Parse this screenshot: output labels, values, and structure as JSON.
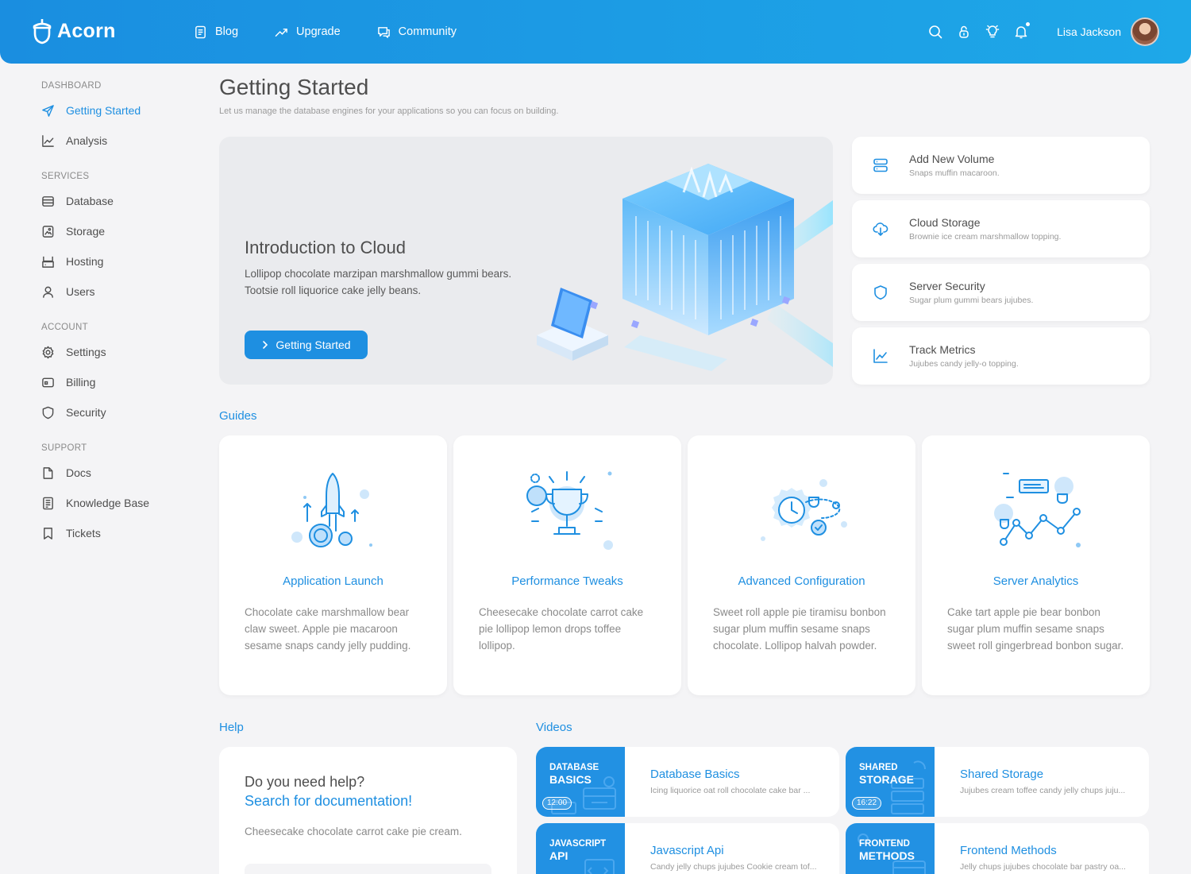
{
  "app": {
    "name": "Acorn"
  },
  "topnav": [
    {
      "label": "Blog",
      "icon": "blog-icon"
    },
    {
      "label": "Upgrade",
      "icon": "trend-up-icon"
    },
    {
      "label": "Community",
      "icon": "chat-icon"
    }
  ],
  "topbar_right": {
    "icons": [
      "search-icon",
      "lock-icon",
      "lightbulb-icon",
      "bell-icon"
    ],
    "user_name": "Lisa Jackson"
  },
  "sidebar": {
    "sections": [
      {
        "title": "DASHBOARD",
        "items": [
          {
            "label": "Getting Started",
            "icon": "send-icon",
            "active": true
          },
          {
            "label": "Analysis",
            "icon": "chart-line-icon"
          }
        ]
      },
      {
        "title": "SERVICES",
        "items": [
          {
            "label": "Database",
            "icon": "database-icon"
          },
          {
            "label": "Storage",
            "icon": "storage-icon"
          },
          {
            "label": "Hosting",
            "icon": "hosting-icon"
          },
          {
            "label": "Users",
            "icon": "user-icon"
          }
        ]
      },
      {
        "title": "ACCOUNT",
        "items": [
          {
            "label": "Settings",
            "icon": "gear-icon"
          },
          {
            "label": "Billing",
            "icon": "credit-card-icon"
          },
          {
            "label": "Security",
            "icon": "shield-icon"
          }
        ]
      },
      {
        "title": "SUPPORT",
        "items": [
          {
            "label": "Docs",
            "icon": "file-icon"
          },
          {
            "label": "Knowledge Base",
            "icon": "book-icon"
          },
          {
            "label": "Tickets",
            "icon": "bookmark-icon"
          }
        ]
      }
    ]
  },
  "page": {
    "title": "Getting Started",
    "subtitle": "Let us manage the database engines for your applications so you can focus on building."
  },
  "hero": {
    "title": "Introduction to Cloud",
    "text": "Lollipop chocolate marzipan marshmallow gummi bears. Tootsie roll liquorice cake jelly beans.",
    "button_label": "Getting Started"
  },
  "actions": [
    {
      "title": "Add New Volume",
      "desc": "Snaps muffin macaroon.",
      "icon": "server-icon"
    },
    {
      "title": "Cloud Storage",
      "desc": "Brownie ice cream marshmallow topping.",
      "icon": "cloud-download-icon"
    },
    {
      "title": "Server Security",
      "desc": "Sugar plum gummi bears jujubes.",
      "icon": "shield-icon"
    },
    {
      "title": "Track Metrics",
      "desc": "Jujubes candy jelly-o topping.",
      "icon": "chart-line-icon"
    }
  ],
  "guides": {
    "label": "Guides",
    "items": [
      {
        "title": "Application Launch",
        "text": "Chocolate cake marshmallow bear claw sweet. Apple pie macaroon sesame snaps candy jelly pudding.",
        "icon": "rocket-icon"
      },
      {
        "title": "Performance Tweaks",
        "text": "Cheesecake chocolate carrot cake pie lollipop lemon drops toffee lollipop.",
        "icon": "trophy-icon"
      },
      {
        "title": "Advanced Configuration",
        "text": "Sweet roll apple pie tiramisu bonbon sugar plum muffin sesame snaps chocolate. Lollipop halvah powder.",
        "icon": "gear-clock-icon"
      },
      {
        "title": "Server Analytics",
        "text": "Cake tart apple pie bear bonbon sugar plum muffin sesame snaps sweet roll gingerbread bonbon sugar.",
        "icon": "analytics-icon"
      }
    ]
  },
  "help": {
    "label": "Help",
    "question": "Do you need help?",
    "link": "Search for documentation!",
    "text": "Cheesecake chocolate carrot cake pie cream."
  },
  "videos": {
    "label": "Videos",
    "items": [
      {
        "thumb_small": "DATABASE",
        "thumb_big": "BASICS",
        "duration": "12:00",
        "title": "Database Basics",
        "desc": "Icing liquorice oat roll chocolate cake bar ..."
      },
      {
        "thumb_small": "SHARED",
        "thumb_big": "STORAGE",
        "duration": "16:22",
        "title": "Shared Storage",
        "desc": "Jujubes cream toffee candy jelly chups juju..."
      },
      {
        "thumb_small": "JAVASCRIPT",
        "thumb_big": "API",
        "duration": "",
        "title": "Javascript Api",
        "desc": "Candy jelly chups jujubes Cookie cream tof..."
      },
      {
        "thumb_small": "FRONTEND",
        "thumb_big": "METHODS",
        "duration": "",
        "title": "Frontend Methods",
        "desc": "Jelly chups jujubes chocolate bar pastry oa..."
      }
    ]
  },
  "colors": {
    "primary": "#1e8fe1",
    "topbar_start": "#1a8ee0",
    "topbar_end": "#1ea8e8",
    "background": "#f4f4f6"
  }
}
